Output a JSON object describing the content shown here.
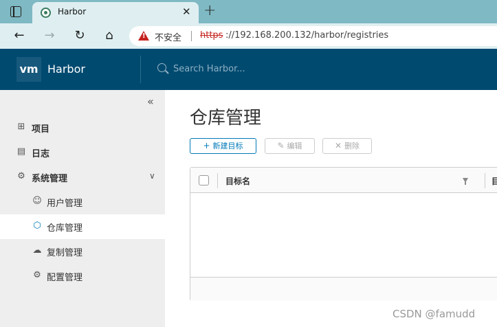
{
  "browser": {
    "tab_title": "Harbor",
    "security_label": "不安全",
    "url_protocol": "https",
    "url_rest": "://192.168.200.132/harbor/registries"
  },
  "header": {
    "logo_text": "vm",
    "app_name": "Harbor",
    "search_placeholder": "Search Harbor..."
  },
  "sidebar": {
    "items": [
      {
        "label": "项目",
        "icon": "projects-icon"
      },
      {
        "label": "日志",
        "icon": "logs-icon"
      },
      {
        "label": "系统管理",
        "icon": "admin-icon"
      },
      {
        "label": "用户管理",
        "icon": "users-icon"
      },
      {
        "label": "仓库管理",
        "icon": "registry-icon"
      },
      {
        "label": "复制管理",
        "icon": "replication-icon"
      },
      {
        "label": "配置管理",
        "icon": "config-icon"
      }
    ]
  },
  "main": {
    "title": "仓库管理",
    "new_button": "新建目标",
    "edit_button": "编辑",
    "delete_button": "删除",
    "columns": [
      "目标名",
      "目"
    ]
  },
  "watermark": "CSDN @famudd",
  "colors": {
    "header_bg": "#004a70",
    "accent": "#0079b8",
    "sidebar_bg": "#eeeeee"
  }
}
